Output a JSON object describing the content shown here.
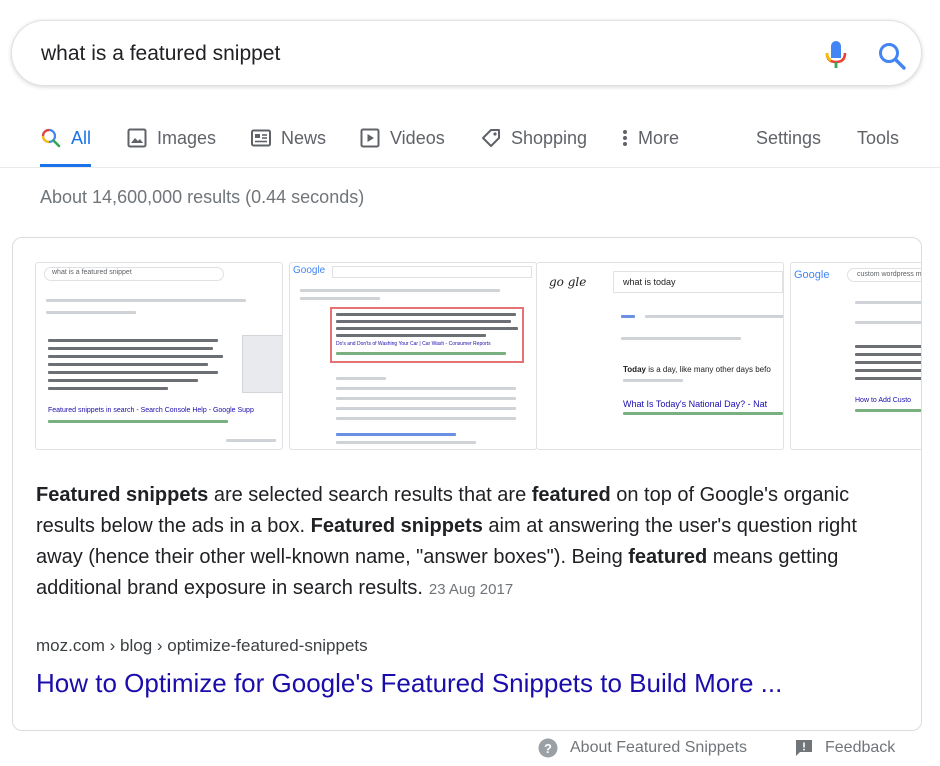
{
  "search": {
    "query": "what is a featured snippet",
    "mic_icon": "mic-icon",
    "search_icon": "search-icon"
  },
  "tabs": [
    {
      "label": "All",
      "icon": "search-icon",
      "active": true
    },
    {
      "label": "Images",
      "icon": "image-icon"
    },
    {
      "label": "News",
      "icon": "news-icon"
    },
    {
      "label": "Videos",
      "icon": "play-icon"
    },
    {
      "label": "Shopping",
      "icon": "tag-icon"
    },
    {
      "label": "More",
      "icon": "more-vert-icon"
    },
    {
      "label": "Settings"
    },
    {
      "label": "Tools"
    }
  ],
  "stats": "About 14,600,000 results (0.44 seconds)",
  "thumbnails": [
    {
      "query": "what is a featured snippet",
      "caption": "Featured snippets in search - Search Console Help - Google Supp"
    },
    {
      "logo": "Google",
      "caption": "Do's and Don'ts of Washing Your Car | Car Wash - Consumer Reports"
    },
    {
      "logo": "go gle",
      "query": "what is today",
      "result_lead": "Today",
      "result_text": "is a day, like many other days befo",
      "caption": "What Is Today's National Day? - Nat"
    },
    {
      "logo": "Google",
      "query": "custom wordpress m",
      "caption": "How to Add Custo"
    }
  ],
  "snippet": {
    "parts": [
      {
        "text": "Featured snippets",
        "bold": true
      },
      {
        "text": " are selected search results that are ",
        "bold": false
      },
      {
        "text": "featured",
        "bold": true
      },
      {
        "text": " on top of Google's organic results below the ads in a box. ",
        "bold": false
      },
      {
        "text": "Featured snippets",
        "bold": true
      },
      {
        "text": " aim at answering the user's question right away (hence their other well-known name, \"answer boxes\"). Being ",
        "bold": false
      },
      {
        "text": "featured",
        "bold": true
      },
      {
        "text": " means getting additional brand exposure in search results.",
        "bold": false
      }
    ],
    "date": "23 Aug 2017"
  },
  "result": {
    "breadcrumb": "moz.com › blog › optimize-featured-snippets",
    "title": "How to Optimize for Google's Featured Snippets to Build More ..."
  },
  "footer": {
    "about": "About Featured Snippets",
    "about_icon": "help-circle-icon",
    "feedback": "Feedback",
    "feedback_icon": "feedback-icon"
  },
  "colors": {
    "link": "#1a0dab",
    "accent": "#1a73e8",
    "muted": "#70757a"
  }
}
